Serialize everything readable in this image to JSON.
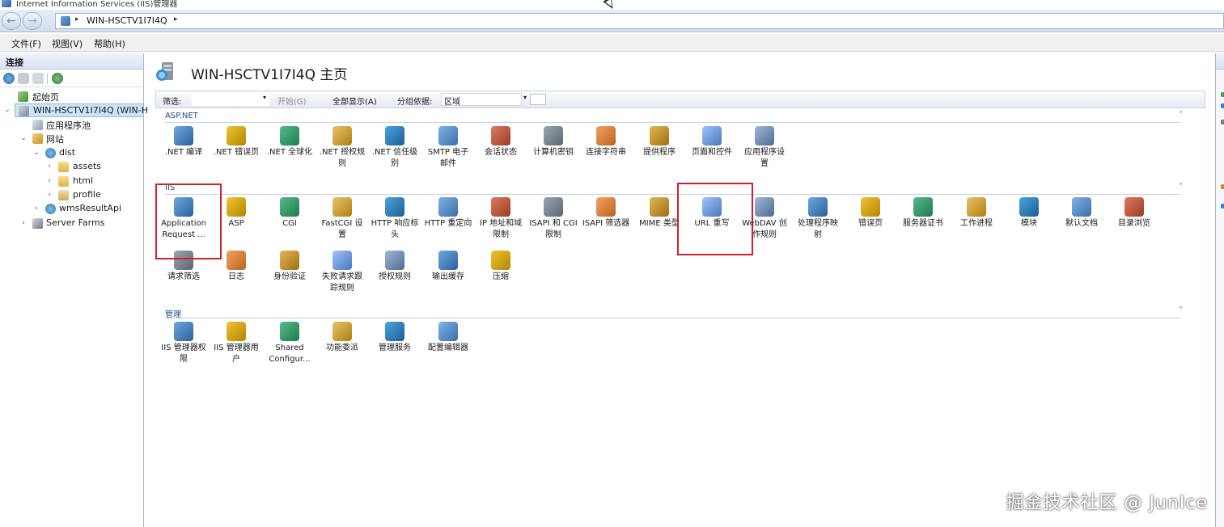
{
  "window": {
    "title": "Internet Information Services (IIS)管理器"
  },
  "nav": {
    "back": "←",
    "forward": "→",
    "crumb": "WIN-HSCTV1I7I4Q",
    "sep": "▸"
  },
  "menu": [
    "文件(F)",
    "视图(V)",
    "帮助(H)"
  ],
  "connections": {
    "title": "连接",
    "tree": [
      {
        "label": "起始页"
      },
      {
        "label": "WIN-HSCTV1I7I4Q (WIN-H",
        "expander": "⌄"
      },
      {
        "label": "应用程序池"
      },
      {
        "label": "网站",
        "expander": "⌄"
      },
      {
        "label": "dist",
        "expander": "⌄"
      },
      {
        "label": "assets",
        "expander": "›"
      },
      {
        "label": "html",
        "expander": "›"
      },
      {
        "label": "profile",
        "expander": "›"
      },
      {
        "label": "wmsResultApi",
        "expander": "›"
      },
      {
        "label": "Server Farms",
        "expander": "›"
      }
    ]
  },
  "page": {
    "title": "WIN-HSCTV1I7I4Q 主页"
  },
  "filter": {
    "label": "筛选:",
    "start": "开始(G)",
    "show_all": "全部显示(A)",
    "group_by": "分组依据:",
    "group_value": "区域",
    "drop": "▾"
  },
  "groups": {
    "aspnet": {
      "title": "ASP.NET",
      "collapse": "˄",
      "items": [
        {
          "l1": ".NET 编译",
          "l2": ""
        },
        {
          "l1": ".NET 错误页",
          "l2": ""
        },
        {
          "l1": ".NET 全球化",
          "l2": ""
        },
        {
          "l1": ".NET 授权规",
          "l2": "则"
        },
        {
          "l1": ".NET 信任级",
          "l2": "别"
        },
        {
          "l1": "SMTP 电子",
          "l2": "邮件"
        },
        {
          "l1": "会话状态",
          "l2": ""
        },
        {
          "l1": "计算机密钥",
          "l2": ""
        },
        {
          "l1": "连接字符串",
          "l2": ""
        },
        {
          "l1": "提供程序",
          "l2": ""
        },
        {
          "l1": "页面和控件",
          "l2": ""
        },
        {
          "l1": "应用程序设",
          "l2": "置"
        }
      ]
    },
    "iis": {
      "title": "IIS",
      "collapse": "˄",
      "items": [
        {
          "l1": "Application",
          "l2": "Request ..."
        },
        {
          "l1": "ASP",
          "l2": ""
        },
        {
          "l1": "CGI",
          "l2": ""
        },
        {
          "l1": "FastCGI 设",
          "l2": "置"
        },
        {
          "l1": "HTTP 响应标",
          "l2": "头"
        },
        {
          "l1": "HTTP 重定向",
          "l2": ""
        },
        {
          "l1": "IP 地址和域",
          "l2": "限制"
        },
        {
          "l1": "ISAPI 和 CGI",
          "l2": "限制"
        },
        {
          "l1": "ISAPI 筛选器",
          "l2": ""
        },
        {
          "l1": "MIME 类型",
          "l2": ""
        },
        {
          "l1": "URL 重写",
          "l2": ""
        },
        {
          "l1": "WebDAV 创",
          "l2": "作规则"
        },
        {
          "l1": "处理程序映",
          "l2": "射"
        },
        {
          "l1": "错误页",
          "l2": ""
        },
        {
          "l1": "服务器证书",
          "l2": ""
        },
        {
          "l1": "工作进程",
          "l2": ""
        },
        {
          "l1": "模块",
          "l2": ""
        },
        {
          "l1": "默认文档",
          "l2": ""
        },
        {
          "l1": "目录浏览",
          "l2": ""
        },
        {
          "l1": "请求筛选",
          "l2": ""
        },
        {
          "l1": "日志",
          "l2": ""
        },
        {
          "l1": "身份验证",
          "l2": ""
        },
        {
          "l1": "失败请求跟",
          "l2": "踪规则"
        },
        {
          "l1": "授权规则",
          "l2": ""
        },
        {
          "l1": "输出缓存",
          "l2": ""
        },
        {
          "l1": "压缩",
          "l2": ""
        }
      ]
    },
    "management": {
      "title": "管理",
      "collapse": "˄",
      "items": [
        {
          "l1": "IIS 管理器权",
          "l2": "限"
        },
        {
          "l1": "IIS 管理器用",
          "l2": "户"
        },
        {
          "l1": "Shared",
          "l2": "Configur..."
        },
        {
          "l1": "功能委派",
          "l2": ""
        },
        {
          "l1": "管理服务",
          "l2": ""
        },
        {
          "l1": "配置编辑器",
          "l2": ""
        }
      ]
    }
  },
  "watermark": "掘金技术社区 @ JunIce"
}
